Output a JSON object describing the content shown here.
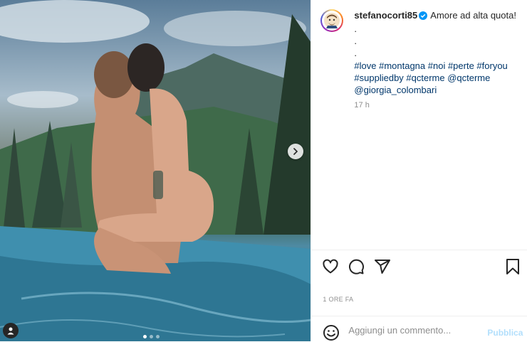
{
  "post": {
    "username": "stefanocorti85",
    "verified": true,
    "caption": "Amore ad alta quota!",
    "dot_lines": [
      ".",
      ".",
      "."
    ],
    "hashtags_text": "#love #montagna #noi #perte #foryou #suppliedby #qcterme @qcterme @giorgia_colombari",
    "relative_time": "17 h",
    "timestamp_label": "1 ORE FA"
  },
  "carousel": {
    "total": 3,
    "current": 1
  },
  "actions": {
    "like_icon": "heart-icon",
    "comment_icon": "comment-bubble-icon",
    "share_icon": "paper-plane-icon",
    "save_icon": "bookmark-icon"
  },
  "comment_box": {
    "placeholder": "Aggiungi un commento...",
    "value": "",
    "publish_label": "Pubblica"
  },
  "colors": {
    "link": "#00376b",
    "publish_disabled": "#b2dffc",
    "verified": "#0095f6",
    "muted": "#8e8e8e"
  }
}
